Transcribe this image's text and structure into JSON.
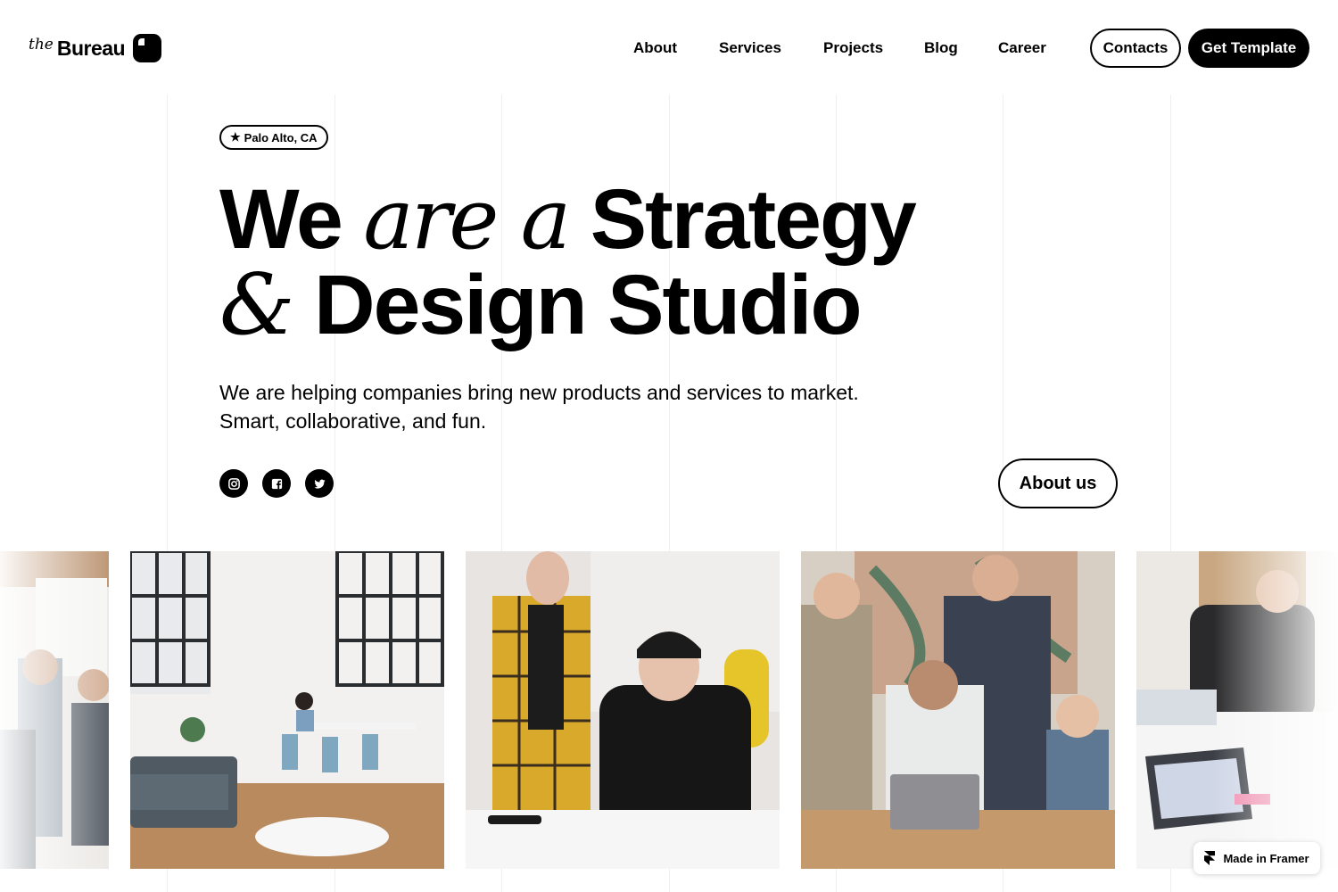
{
  "header": {
    "logo_prefix": "the",
    "logo_name": "Bureau",
    "nav": [
      "About",
      "Services",
      "Projects",
      "Blog",
      "Career"
    ],
    "contacts_label": "Contacts",
    "cta_label": "Get Template"
  },
  "hero": {
    "location_badge": "Palo Alto, CA",
    "badge_icon": "star-icon",
    "headline": {
      "line1_bold_1": "We",
      "line1_serif": "are a",
      "line1_bold_2": "Strategy",
      "line2_serif": "&",
      "line2_bold": "Design Studio"
    },
    "subtitle_line1": "We are helping companies bring new products and services to market.",
    "subtitle_line2": "Smart, collaborative, and fun.",
    "social_icons": [
      "instagram-icon",
      "facebook-icon",
      "twitter-icon"
    ],
    "about_button": "About us"
  },
  "gallery": {
    "photos": [
      "team-meeting-photo",
      "office-workspace-photo",
      "designers-collaborating-photo",
      "team-laptop-photo",
      "man-at-desk-photo"
    ]
  },
  "badge": {
    "label": "Made in Framer"
  },
  "colors": {
    "text": "#000000",
    "background": "#ffffff",
    "gridline": "#efefef"
  }
}
